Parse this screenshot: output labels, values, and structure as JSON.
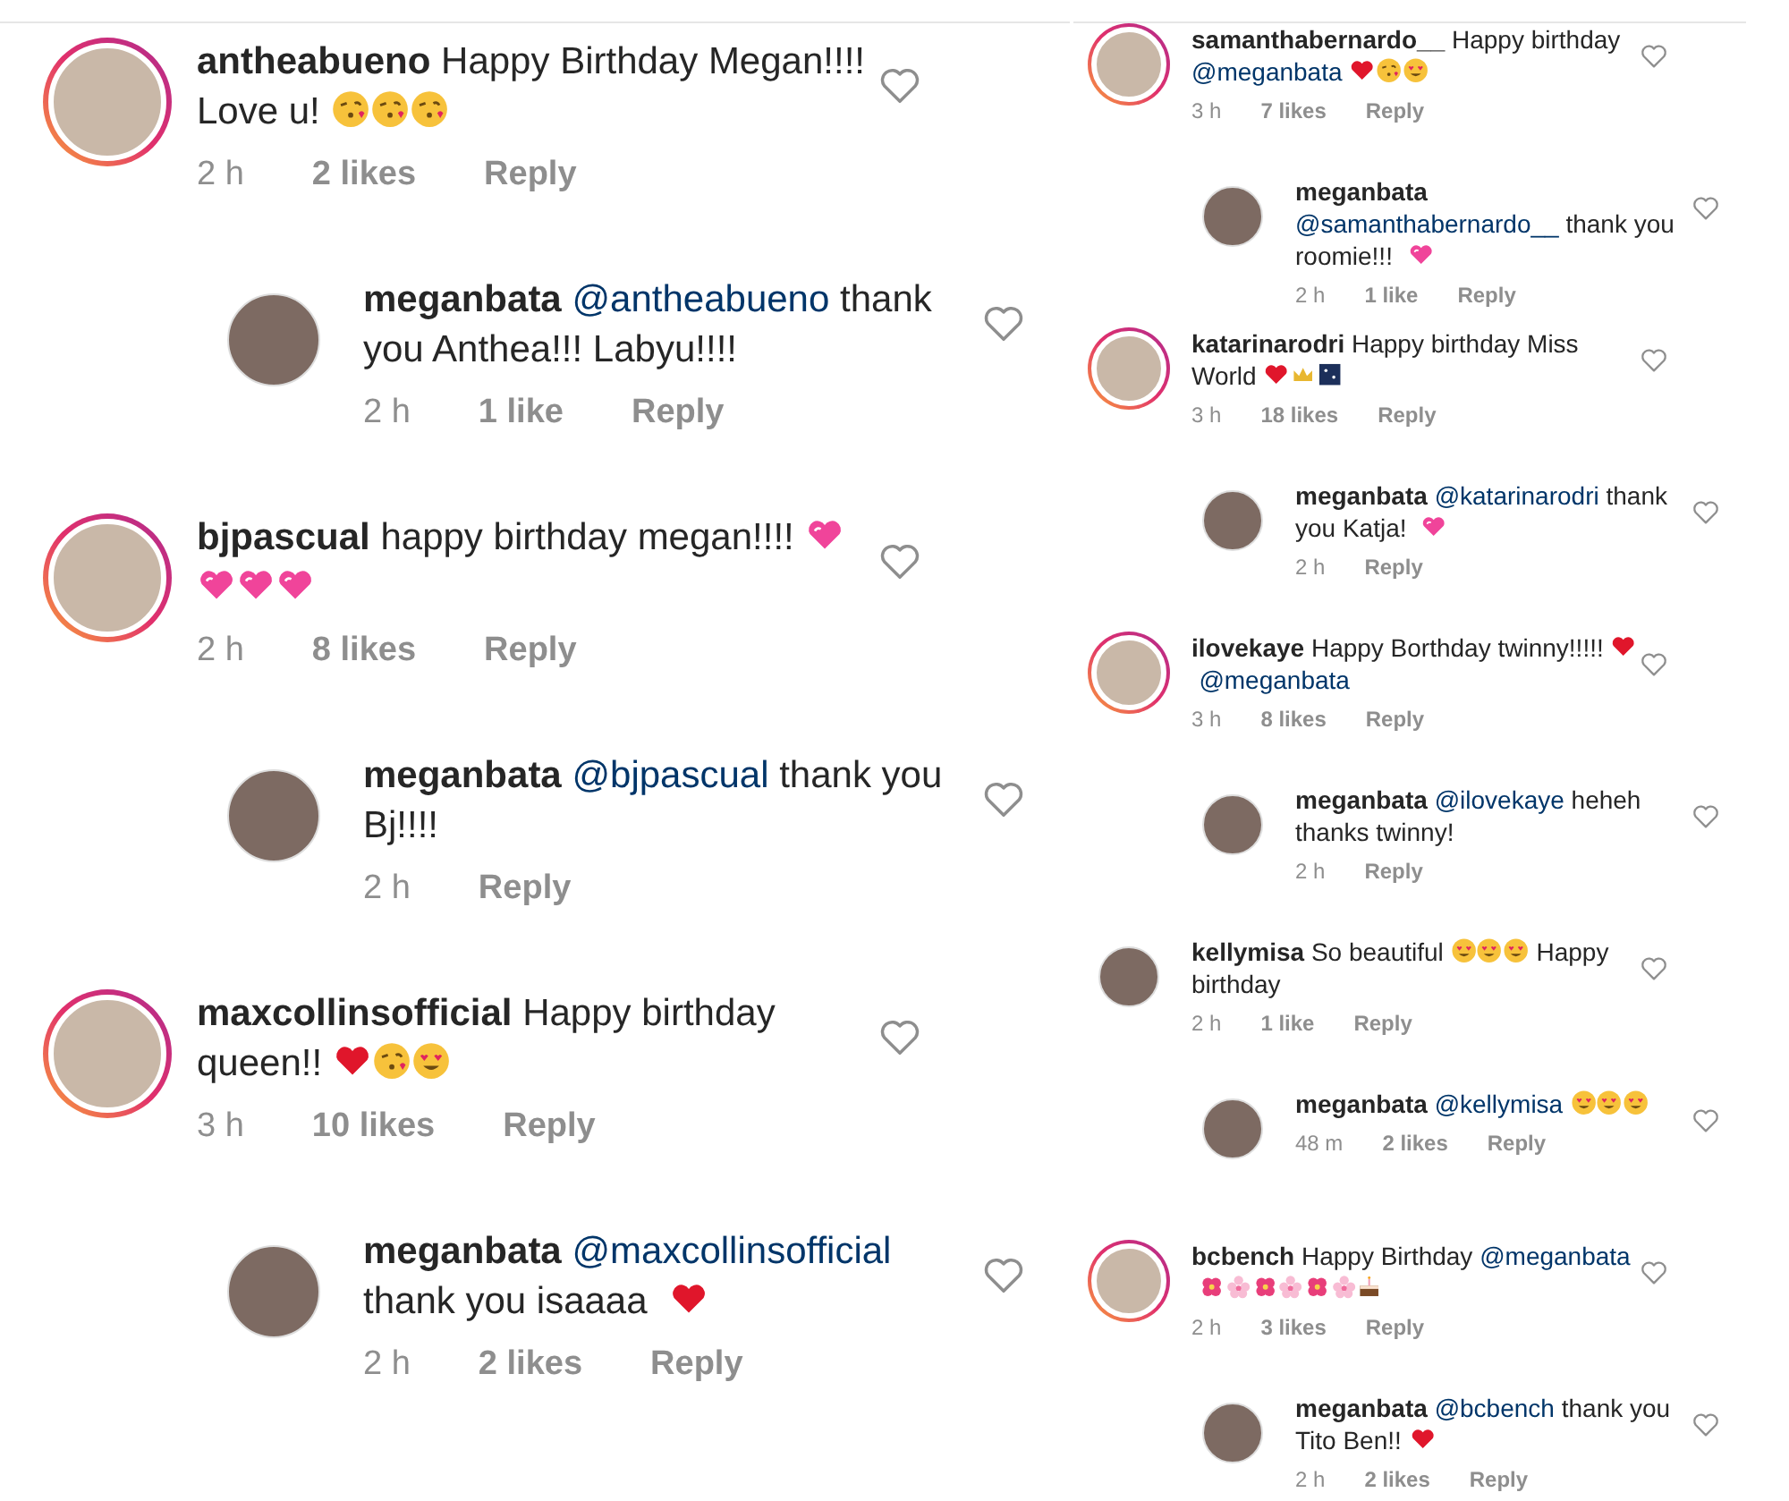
{
  "panels": [
    {
      "comments": [
        {
          "user": "antheabueno",
          "ring": true,
          "parts": [
            {
              "kind": "text",
              "text": "Happy Birthday Megan!!!! Love u! "
            },
            {
              "kind": "kiss-emoji"
            },
            {
              "kind": "kiss-emoji"
            },
            {
              "kind": "kiss-emoji"
            }
          ],
          "time": "2 h",
          "likes": "2 likes",
          "reply": "Reply",
          "replies": [
            {
              "user": "meganbata",
              "ring": false,
              "parts": [
                {
                  "kind": "mention",
                  "text": "@antheabueno"
                },
                {
                  "kind": "text",
                  "text": " thank you Anthea!!! Labyu!!!!"
                }
              ],
              "time": "2 h",
              "likes": "1 like",
              "reply": "Reply"
            }
          ]
        },
        {
          "user": "bjpascual",
          "ring": true,
          "parts": [
            {
              "kind": "text",
              "text": "happy birthday megan!!!! "
            },
            {
              "kind": "pink-heart-emoji"
            },
            {
              "kind": "pink-heart-emoji"
            },
            {
              "kind": "pink-heart-emoji"
            },
            {
              "kind": "pink-heart-emoji"
            }
          ],
          "time": "2 h",
          "likes": "8 likes",
          "reply": "Reply",
          "replies": [
            {
              "user": "meganbata",
              "ring": false,
              "parts": [
                {
                  "kind": "mention",
                  "text": "@bjpascual"
                },
                {
                  "kind": "text",
                  "text": " thank you Bj!!!!"
                }
              ],
              "time": "2 h",
              "reply": "Reply"
            }
          ]
        },
        {
          "user": "maxcollinsofficial",
          "ring": true,
          "parts": [
            {
              "kind": "text",
              "text": "Happy birthday queen!! "
            },
            {
              "kind": "red-heart-emoji"
            },
            {
              "kind": "kiss-emoji"
            },
            {
              "kind": "heart-eyes-emoji"
            }
          ],
          "time": "3 h",
          "likes": "10 likes",
          "reply": "Reply",
          "replies": [
            {
              "user": "meganbata",
              "ring": false,
              "parts": [
                {
                  "kind": "mention",
                  "text": "@maxcollinsofficial"
                },
                {
                  "kind": "text",
                  "text": " thank you isaaaa "
                },
                {
                  "kind": "red-heart-emoji"
                }
              ],
              "time": "2 h",
              "likes": "2 likes",
              "reply": "Reply"
            }
          ]
        }
      ]
    },
    {
      "comments": [
        {
          "user": "samanthabernardo__",
          "ring": true,
          "parts": [
            {
              "kind": "text",
              "text": "Happy birthday "
            },
            {
              "kind": "mention",
              "text": "@meganbata"
            },
            {
              "kind": "red-heart-emoji"
            },
            {
              "kind": "kiss-emoji"
            },
            {
              "kind": "heart-eyes-emoji"
            }
          ],
          "time": "3 h",
          "likes": "7 likes",
          "reply": "Reply",
          "replies": [
            {
              "user": "meganbata",
              "ring": false,
              "parts": [
                {
                  "kind": "mention",
                  "text": "@samanthabernardo__"
                },
                {
                  "kind": "text",
                  "text": " thank you roomie!!! "
                },
                {
                  "kind": "pink-heart-emoji"
                }
              ],
              "time": "2 h",
              "likes": "1 like",
              "reply": "Reply"
            }
          ]
        },
        {
          "user": "katarinarodri",
          "ring": true,
          "parts": [
            {
              "kind": "text",
              "text": "Happy birthday Miss World "
            },
            {
              "kind": "red-heart-emoji"
            },
            {
              "kind": "crown-emoji"
            },
            {
              "kind": "night-emoji"
            }
          ],
          "time": "3 h",
          "likes": "18 likes",
          "reply": "Reply",
          "replies": [
            {
              "user": "meganbata",
              "ring": false,
              "parts": [
                {
                  "kind": "mention",
                  "text": "@katarinarodri"
                },
                {
                  "kind": "text",
                  "text": " thank you Katja! "
                },
                {
                  "kind": "pink-heart-emoji"
                }
              ],
              "time": "2 h",
              "reply": "Reply"
            }
          ]
        },
        {
          "user": "ilovekaye",
          "ring": true,
          "parts": [
            {
              "kind": "text",
              "text": "Happy Borthday twinny!!!!! "
            },
            {
              "kind": "red-heart-emoji"
            },
            {
              "kind": "mention",
              "text": "@meganbata"
            }
          ],
          "time": "3 h",
          "likes": "8 likes",
          "reply": "Reply",
          "replies": [
            {
              "user": "meganbata",
              "ring": false,
              "parts": [
                {
                  "kind": "mention",
                  "text": "@ilovekaye"
                },
                {
                  "kind": "text",
                  "text": " heheh thanks twinny!"
                }
              ],
              "time": "2 h",
              "reply": "Reply"
            }
          ]
        },
        {
          "user": "kellymisa",
          "ring": false,
          "parts": [
            {
              "kind": "text",
              "text": "So beautiful "
            },
            {
              "kind": "heart-eyes-emoji"
            },
            {
              "kind": "heart-eyes-emoji"
            },
            {
              "kind": "heart-eyes-emoji"
            },
            {
              "kind": "text",
              "text": " Happy birthday"
            }
          ],
          "time": "2 h",
          "likes": "1 like",
          "reply": "Reply",
          "replies": [
            {
              "user": "meganbata",
              "ring": false,
              "parts": [
                {
                  "kind": "mention",
                  "text": "@kellymisa"
                },
                {
                  "kind": "heart-eyes-emoji"
                },
                {
                  "kind": "heart-eyes-emoji"
                },
                {
                  "kind": "heart-eyes-emoji"
                }
              ],
              "time": "48 m",
              "likes": "2 likes",
              "reply": "Reply"
            }
          ]
        },
        {
          "user": "bcbench",
          "ring": true,
          "parts": [
            {
              "kind": "text",
              "text": "Happy Birthday "
            },
            {
              "kind": "mention",
              "text": "@meganbata"
            },
            {
              "kind": "flower-emoji"
            },
            {
              "kind": "blossom-emoji"
            },
            {
              "kind": "flower-emoji"
            },
            {
              "kind": "blossom-emoji"
            },
            {
              "kind": "flower-emoji"
            },
            {
              "kind": "blossom-emoji"
            },
            {
              "kind": "cake-emoji"
            }
          ],
          "time": "2 h",
          "likes": "3 likes",
          "reply": "Reply",
          "replies": [
            {
              "user": "meganbata",
              "ring": false,
              "parts": [
                {
                  "kind": "mention",
                  "text": "@bcbench"
                },
                {
                  "kind": "text",
                  "text": " thank you Tito Ben!!"
                },
                {
                  "kind": "red-heart-emoji"
                }
              ],
              "time": "2 h",
              "likes": "2 likes",
              "reply": "Reply"
            }
          ]
        }
      ]
    }
  ]
}
